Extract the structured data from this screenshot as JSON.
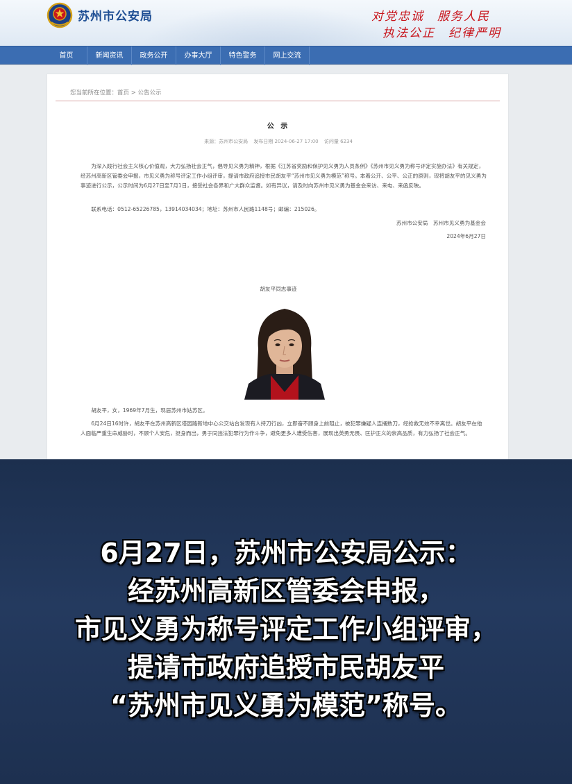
{
  "header": {
    "site_title": "苏州市公安局",
    "slogan_line1": "对党忠诚　服务人民",
    "slogan_line2": "执法公正　纪律严明",
    "emblem_icon": "police-emblem-icon"
  },
  "nav": {
    "items": [
      "首页",
      "新闻资讯",
      "政务公开",
      "办事大厅",
      "特色警务",
      "网上交流"
    ]
  },
  "article": {
    "breadcrumb": "您当前所在位置：首页 > 公告公示",
    "title": "公 示",
    "meta_source": "来源：苏州市公安局",
    "meta_time": "发布日期 2024-06-27 17:00",
    "meta_views": "访问量 6234",
    "para1": "为深入践行社会主义核心价值观，大力弘扬社会正气，倡导见义勇为精神，根据《江苏省奖励和保护见义勇为人员条例》《苏州市见义勇为称号评定实施办法》有关规定，经苏州高新区管委会申报，市见义勇为称号评定工作小组评审，提请市政府追授市民胡友平“苏州市见义勇为模范”称号。本着公开、公平、公正的原则，现将胡友平的见义勇为事迹进行公示，公示时间为6月27日至7月1日，接受社会各界和广大群众监督。如有异议，请及时向苏州市见义勇为基金会来访、来电、来函反映。",
    "contact": "联系电话：0512-65226785，13914034034；地址：苏州市人民路1148号；邮编：215026。",
    "signature": "苏州市公安局　苏州市见义勇为基金会",
    "sign_date": "2024年6月27日",
    "photo_caption": "胡友平同志事迹",
    "bio": "胡友平，女，1969年7月生，现居苏州市姑苏区。",
    "story": "6月24日16时许，胡友平在苏州高新区塔园路新地中心公交站台发现有人持刀行凶，立即奋不顾身上前阻止，被犯罪嫌疑人连捅数刀，经抢救无效不幸离世。胡友平在他人面临严重生命威胁时，不顾个人安危，挺身而出，勇于同违法犯罪行为作斗争，避免更多人遭受伤害，展现出英勇无畏、匡护正义的崇高品质，有力弘扬了社会正气。"
  },
  "overlay_caption": {
    "lines": [
      "6月27日，苏州市公安局公示：",
      "经苏州高新区管委会申报，",
      "市见义勇为称号评定工作小组评审，",
      "提请市政府追授市民胡友平",
      "“苏州市见义勇为模范”称号。"
    ]
  },
  "colors": {
    "brand_blue": "#1d4d93",
    "nav_blue": "#3b6db2",
    "slogan_red": "#c8161d",
    "dark_bg": "#1f3354"
  }
}
